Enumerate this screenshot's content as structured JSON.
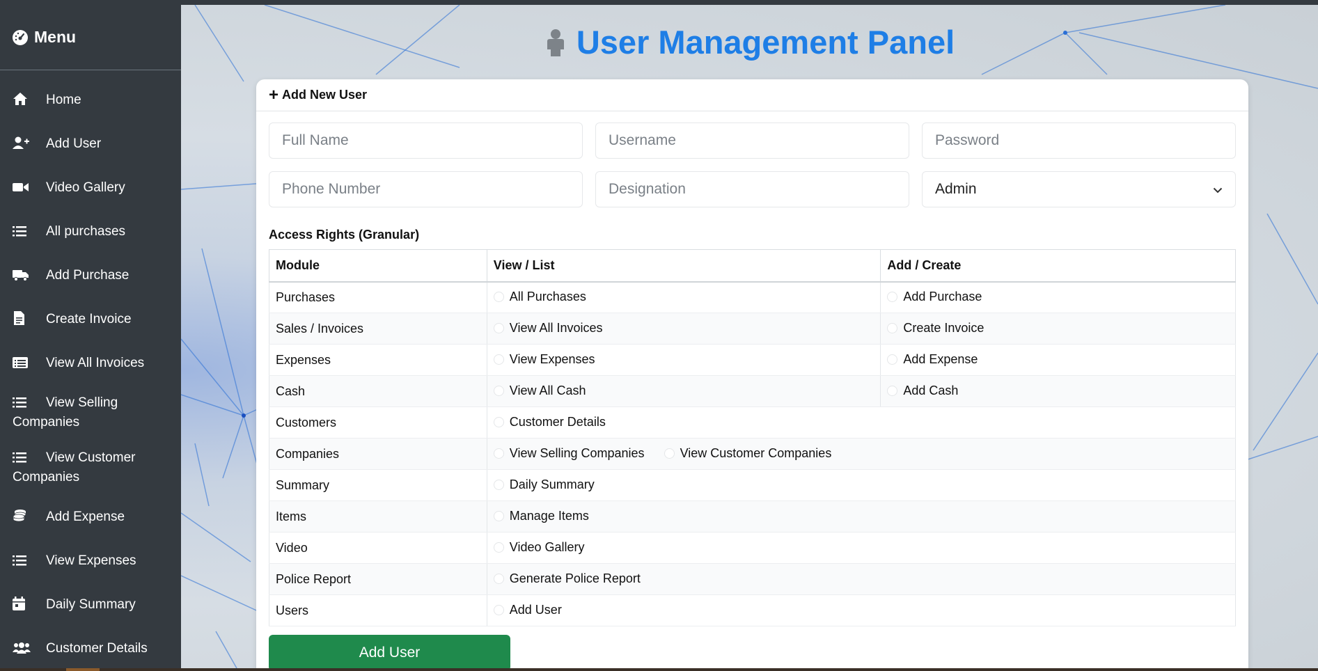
{
  "sidebar": {
    "title": "Menu",
    "items": [
      {
        "label": "Home",
        "icon": "home-icon"
      },
      {
        "label": "Add User",
        "icon": "user-plus-icon"
      },
      {
        "label": "Video Gallery",
        "icon": "video-icon"
      },
      {
        "label": "All purchases",
        "icon": "list-icon"
      },
      {
        "label": "Add Purchase",
        "icon": "truck-icon"
      },
      {
        "label": "Create Invoice",
        "icon": "file-invoice-icon"
      },
      {
        "label": "View All Invoices",
        "icon": "receipt-list-icon"
      },
      {
        "label": "View Selling Companies",
        "icon": "list-icon"
      },
      {
        "label": "View Customer Companies",
        "icon": "list-icon"
      },
      {
        "label": "Add Expense",
        "icon": "coins-icon"
      },
      {
        "label": "View Expenses",
        "icon": "list-icon"
      },
      {
        "label": "Daily Summary",
        "icon": "calendar-icon"
      },
      {
        "label": "Customer Details",
        "icon": "users-icon"
      }
    ]
  },
  "header": {
    "title": "User Management Panel"
  },
  "form": {
    "card_title": "Add New User",
    "fields": {
      "full_name": "Full Name",
      "username": "Username",
      "password": "Password",
      "phone": "Phone Number",
      "designation": "Designation"
    },
    "role_selected": "Admin",
    "access_title": "Access Rights (Granular)",
    "submit_label": "Add User"
  },
  "rights": {
    "headers": [
      "Module",
      "View / List",
      "Add / Create"
    ],
    "rows": [
      {
        "module": "Purchases",
        "view": [
          "All Purchases"
        ],
        "add": [
          "Add Purchase"
        ]
      },
      {
        "module": "Sales / Invoices",
        "view": [
          "View All Invoices"
        ],
        "add": [
          "Create Invoice"
        ]
      },
      {
        "module": "Expenses",
        "view": [
          "View Expenses"
        ],
        "add": [
          "Add Expense"
        ]
      },
      {
        "module": "Cash",
        "view": [
          "View All Cash"
        ],
        "add": [
          "Add Cash"
        ]
      },
      {
        "module": "Customers",
        "view": [
          "Customer Details"
        ],
        "add": []
      },
      {
        "module": "Companies",
        "view": [
          "View Selling Companies",
          "View Customer Companies"
        ],
        "add": []
      },
      {
        "module": "Summary",
        "view": [
          "Daily Summary"
        ],
        "add": []
      },
      {
        "module": "Items",
        "view": [
          "Manage Items"
        ],
        "add": []
      },
      {
        "module": "Video",
        "view": [
          "Video Gallery"
        ],
        "add": []
      },
      {
        "module": "Police Report",
        "view": [
          "Generate Police Report"
        ],
        "add": []
      },
      {
        "module": "Users",
        "view": [
          "Add User"
        ],
        "add": []
      }
    ]
  },
  "colors": {
    "sidebar_bg": "#343a40",
    "title_blue": "#1e7ee6",
    "submit_green": "#1f8a4c"
  }
}
